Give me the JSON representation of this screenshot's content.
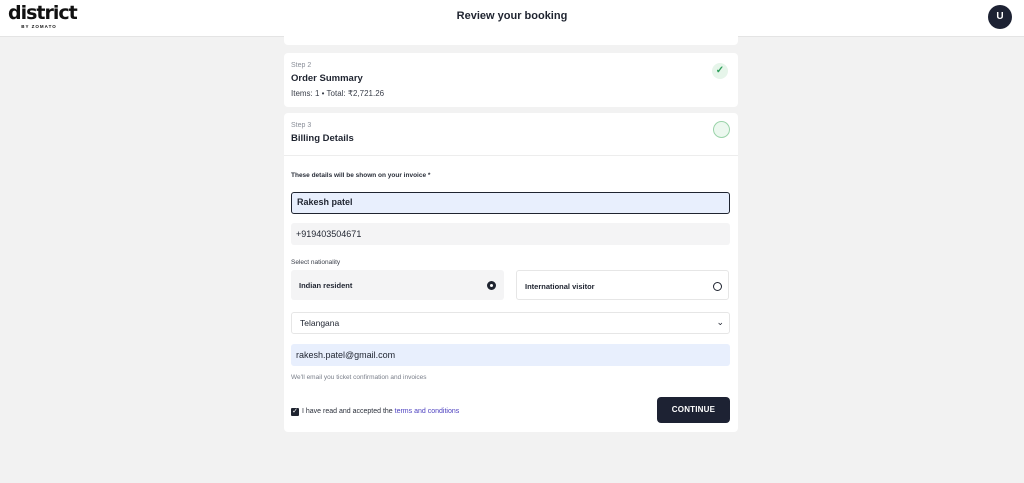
{
  "header": {
    "logo_text": "district",
    "logo_subtext": "BY ZOMATO",
    "title": "Review your booking",
    "avatar_initial": "U"
  },
  "step2": {
    "label": "Step 2",
    "title": "Order Summary",
    "meta": "Items: 1 • Total: ₹2,721.26",
    "status_icon": "check-icon"
  },
  "step3": {
    "label": "Step 3",
    "title": "Billing Details",
    "status_icon": "pending-circle-icon"
  },
  "form": {
    "hint": "These details will be shown on your invoice *",
    "name_value": "Rakesh patel",
    "phone_value": "+919403504671",
    "nationality_label": "Select nationality",
    "nationality_options": [
      {
        "label": "Indian resident",
        "selected": true
      },
      {
        "label": "International visitor",
        "selected": false
      }
    ],
    "state_value": "Telangana",
    "email_value": "rakesh.patel@gmail.com",
    "email_note": "We'll email you ticket confirmation and invoices",
    "terms_prefix": "I have read and accepted the",
    "terms_link": "terms and conditions",
    "terms_checked": true,
    "continue_label": "CONTINUE"
  },
  "colors": {
    "primary_dark": "#1d2233",
    "success_green": "#2e9e5a",
    "link_purple": "#4b3fbf",
    "input_focus_bg": "#e8effd"
  }
}
